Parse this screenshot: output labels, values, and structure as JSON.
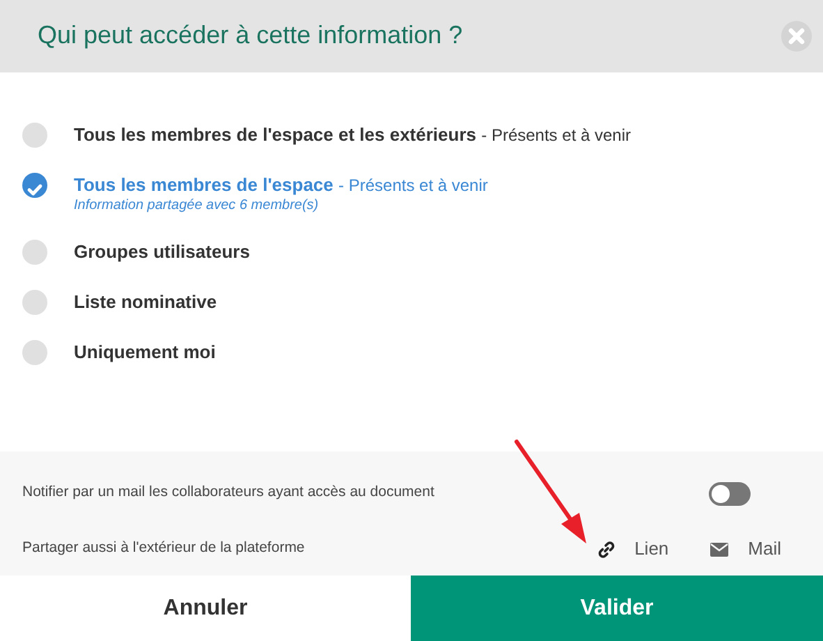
{
  "dialog": {
    "title": "Qui peut accéder à cette information ?"
  },
  "options": [
    {
      "label": "Tous les membres de l'espace et les extérieurs",
      "detail": "- Présents et à venir",
      "selected": false
    },
    {
      "label": "Tous les membres de l'espace",
      "detail": "- Présents et à venir",
      "note": "Information partagée avec 6 membre(s)",
      "selected": true
    },
    {
      "label": "Groupes utilisateurs",
      "selected": false
    },
    {
      "label": "Liste nominative",
      "selected": false
    },
    {
      "label": "Uniquement moi",
      "selected": false
    }
  ],
  "notify": {
    "label": "Notifier par un mail les collaborateurs ayant accès au document",
    "on": false
  },
  "share": {
    "label": "Partager aussi à l'extérieur de la plateforme",
    "links": [
      {
        "kind": "link",
        "label": "Lien"
      },
      {
        "kind": "mail",
        "label": "Mail"
      }
    ]
  },
  "buttons": [
    {
      "kind": "cancel",
      "label": "Annuler"
    },
    {
      "kind": "confirm",
      "label": "Valider"
    }
  ]
}
